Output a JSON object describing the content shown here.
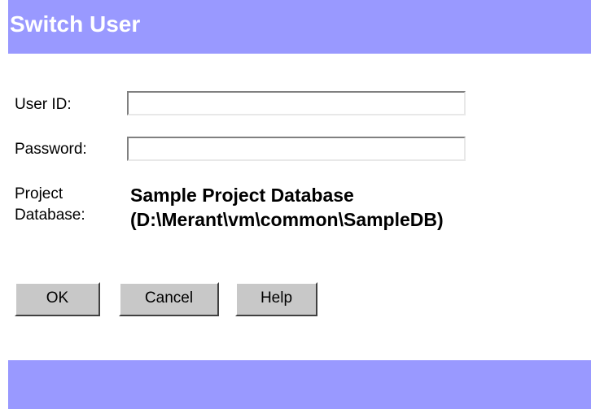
{
  "title": "Switch User",
  "form": {
    "user_id_label": "User ID:",
    "user_id_value": "",
    "password_label": "Password:",
    "password_value": "",
    "project_label_line1": "Project",
    "project_label_line2": "Database:",
    "project_name": "Sample Project Database",
    "project_path": "(D:\\Merant\\vm\\common\\SampleDB)"
  },
  "buttons": {
    "ok": "OK",
    "cancel": "Cancel",
    "help": "Help"
  },
  "colors": {
    "banner": "#9999ff",
    "button_face": "#c8c8c8"
  }
}
